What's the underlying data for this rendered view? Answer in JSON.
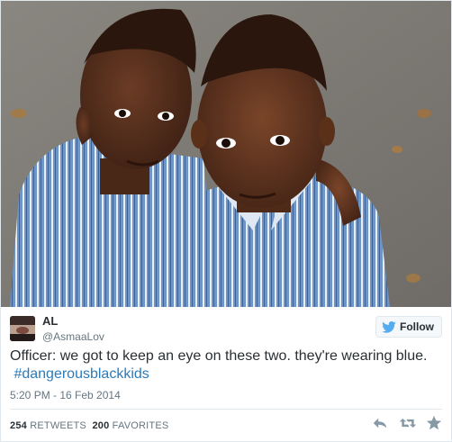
{
  "tweet": {
    "user_name": "AL",
    "user_handle": "@AsmaaLov",
    "follow_label": "Follow",
    "text": "Officer: we got to keep an eye on these two. they're wearing blue.",
    "hashtag": "#dangerousblackkids",
    "timestamp": "5:20 PM - 16 Feb 2014",
    "retweets_count": "254",
    "retweets_label": "RETWEETS",
    "favorites_count": "200",
    "favorites_label": "FAVORITES"
  },
  "icons": {
    "follow": "twitter-bird-icon",
    "reply": "reply-icon",
    "retweet": "retweet-icon",
    "favorite": "star-icon"
  },
  "colors": {
    "link": "#2b7bb9",
    "text": "#292f33",
    "muted": "#66757f",
    "twitter_blue": "#55acee"
  }
}
